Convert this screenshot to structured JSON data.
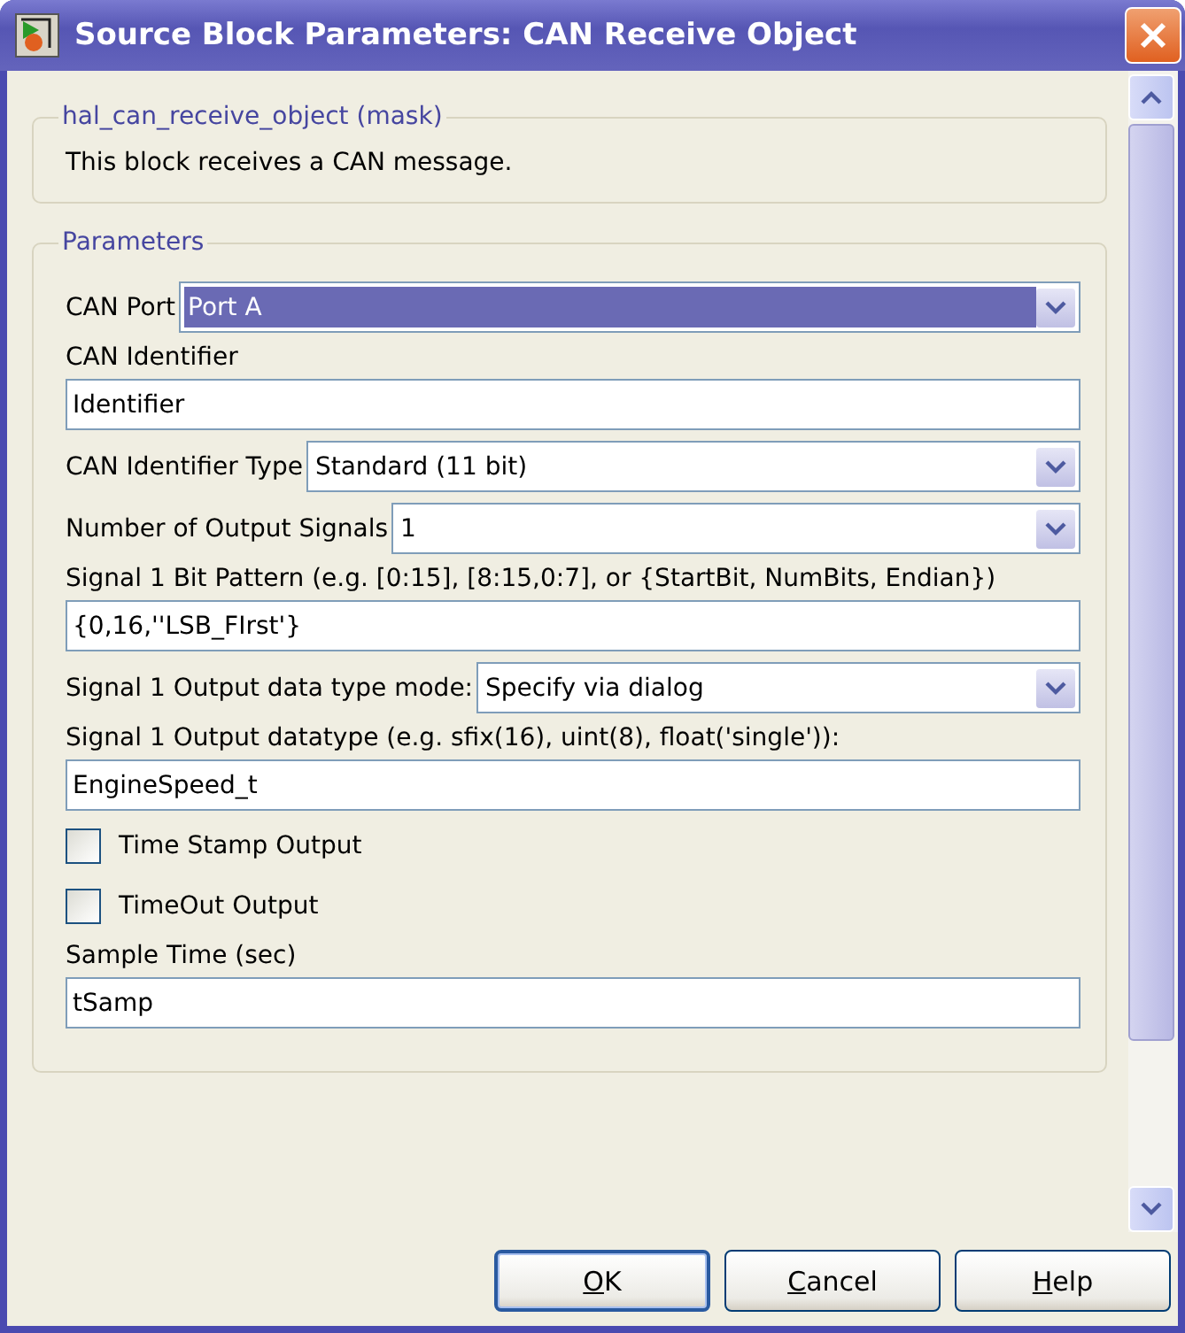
{
  "window": {
    "title": "Source Block Parameters: CAN Receive Object"
  },
  "description_group": {
    "title": "hal_can_receive_object (mask)",
    "text": "This block receives a CAN message."
  },
  "parameters_group": {
    "title": "Parameters",
    "fields": [
      {
        "kind": "dropdown",
        "label": "CAN Port",
        "value": "Port A",
        "focused": true
      },
      {
        "kind": "text",
        "label": "CAN Identifier",
        "value": "Identifier"
      },
      {
        "kind": "dropdown",
        "label": "CAN Identifier Type",
        "value": "Standard (11 bit)",
        "focused": false
      },
      {
        "kind": "dropdown",
        "label": "Number of Output Signals",
        "value": "1",
        "focused": false
      },
      {
        "kind": "text",
        "label": "Signal 1 Bit Pattern (e.g. [0:15], [8:15,0:7], or {StartBit, NumBits, Endian})",
        "value": "{0,16,''LSB_FIrst'}"
      },
      {
        "kind": "dropdown",
        "label": "Signal 1 Output data type mode:",
        "value": "Specify via dialog",
        "focused": false
      },
      {
        "kind": "text",
        "label": "Signal 1 Output datatype (e.g. sfix(16), uint(8), float('single')):",
        "value": "EngineSpeed_t"
      },
      {
        "kind": "checkbox",
        "label": "Time Stamp Output",
        "checked": false
      },
      {
        "kind": "checkbox",
        "label": "TimeOut Output",
        "checked": false
      },
      {
        "kind": "text",
        "label": "Sample Time (sec)",
        "value": "tSamp"
      }
    ]
  },
  "buttons": [
    {
      "mnemonic": "O",
      "rest": "K",
      "default": true
    },
    {
      "mnemonic": "C",
      "rest": "ancel",
      "default": false
    },
    {
      "mnemonic": "H",
      "rest": "elp",
      "default": false
    }
  ]
}
